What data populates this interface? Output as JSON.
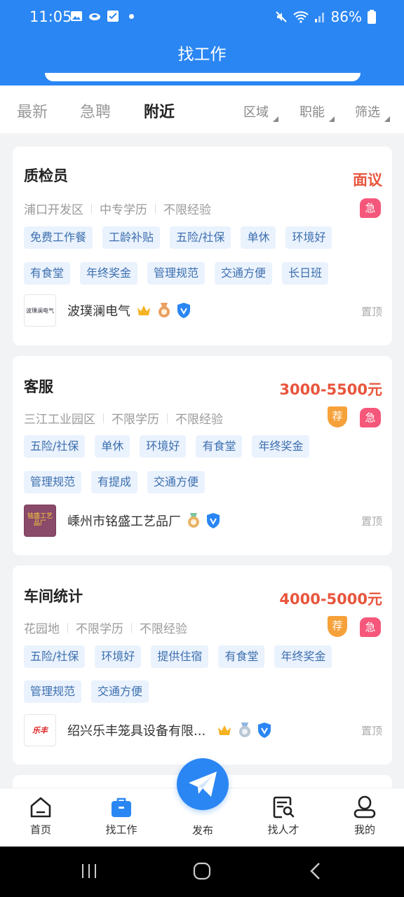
{
  "status": {
    "time": "11:05",
    "battery": "86%"
  },
  "header": {
    "title": "找工作"
  },
  "tabs": [
    {
      "label": "最新",
      "active": false
    },
    {
      "label": "急聘",
      "active": false
    },
    {
      "label": "附近",
      "active": true
    }
  ],
  "filters": [
    "区域",
    "职能",
    "筛选"
  ],
  "jobs": [
    {
      "title": "质检员",
      "salary": "面议",
      "meta": [
        "浦口开发区",
        "中专学历",
        "不限经验"
      ],
      "badges": [
        "急"
      ],
      "tags_row1": [
        "免费工作餐",
        "工龄补贴",
        "五险/社保",
        "单休",
        "环境好"
      ],
      "tags_row2": [
        "有食堂",
        "年终奖金",
        "管理规范",
        "交通方便",
        "长日班"
      ],
      "company": "波璞澜电气",
      "logo_text": "波璞澜电气",
      "pin": "置顶"
    },
    {
      "title": "客服",
      "salary": "3000-5500元",
      "meta": [
        "三江工业园区",
        "不限学历",
        "不限经验"
      ],
      "badges": [
        "荐",
        "急"
      ],
      "tags_row1": [
        "五险/社保",
        "单休",
        "环境好",
        "有食堂",
        "年终奖金"
      ],
      "tags_row2": [
        "管理规范",
        "有提成",
        "交通方便"
      ],
      "company": "嵊州市铭盛工艺品厂",
      "logo_text": "铭盛工艺品厂",
      "pin": "置顶"
    },
    {
      "title": "车间统计",
      "salary": "4000-5000元",
      "meta": [
        "花园地",
        "不限学历",
        "不限经验"
      ],
      "badges": [
        "荐",
        "急"
      ],
      "tags_row1": [
        "五险/社保",
        "环境好",
        "提供住宿",
        "有食堂",
        "年终奖金"
      ],
      "tags_row2": [
        "管理规范",
        "交通方便"
      ],
      "company": "绍兴乐丰笼具设备有限...",
      "logo_text": "乐丰",
      "pin": "置顶"
    }
  ],
  "tabbar": {
    "home": "首页",
    "jobs": "找工作",
    "publish": "发布",
    "talent": "找人才",
    "mine": "我的"
  },
  "colors": {
    "brand": "#2a86f3",
    "salary": "#e8553c",
    "urgent": "#f5577a",
    "recommend": "#f6a13a",
    "tag_bg": "#eaf2fd"
  }
}
